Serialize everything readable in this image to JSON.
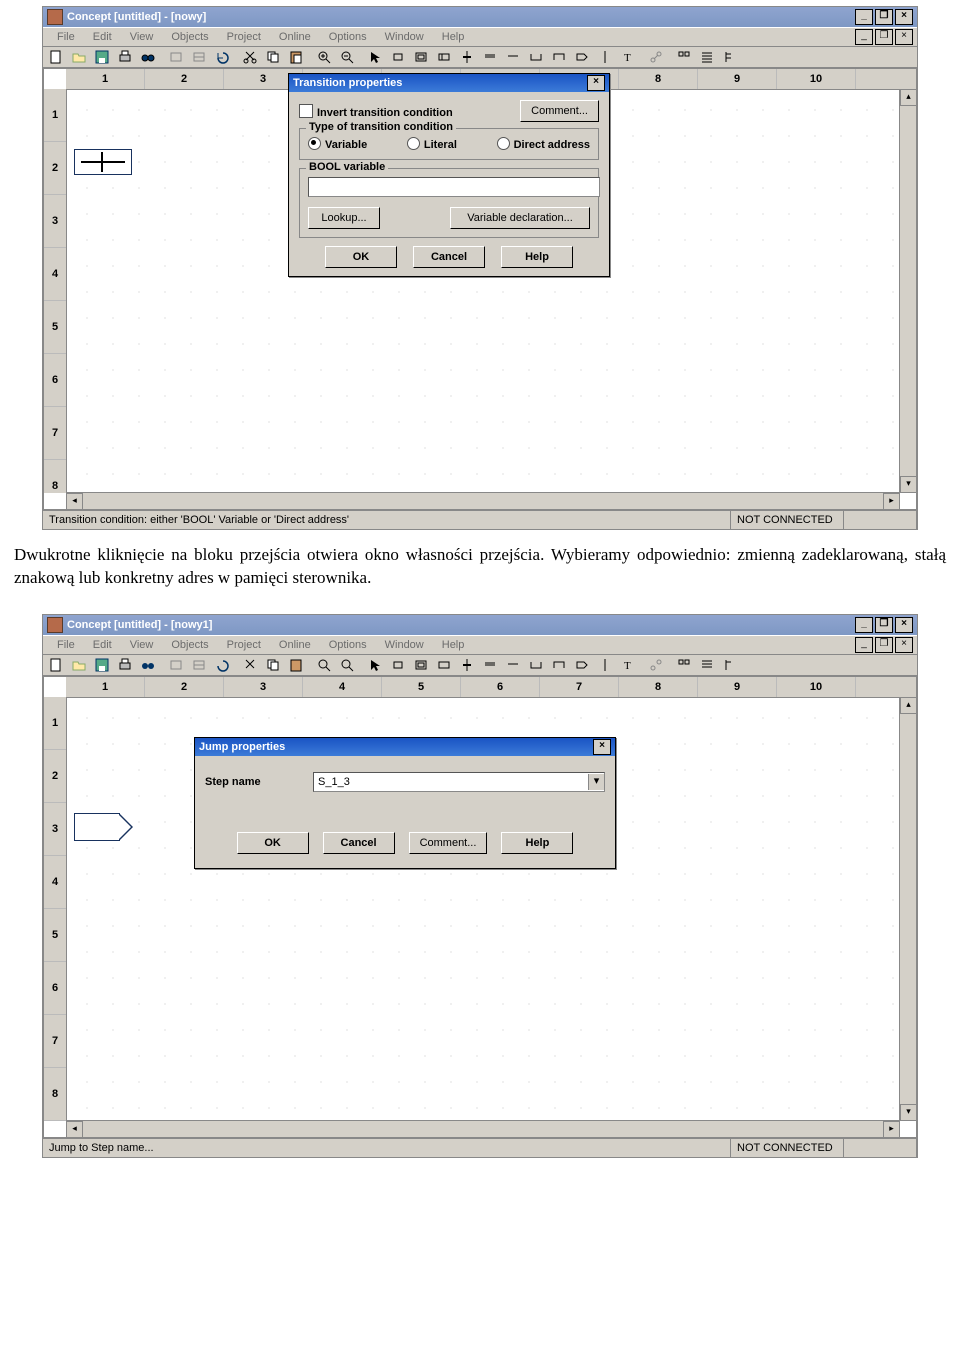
{
  "screenshot1": {
    "title": "Concept [untitled] - [nowy]",
    "menu": [
      "File",
      "Edit",
      "View",
      "Objects",
      "Project",
      "Online",
      "Options",
      "Window",
      "Help"
    ],
    "ruler_cols": [
      "1",
      "2",
      "3",
      "",
      "",
      "",
      "",
      "8",
      "9",
      "10"
    ],
    "ruler_rows": [
      "1",
      "2",
      "3",
      "4",
      "5",
      "6",
      "7",
      "8"
    ],
    "dialog": {
      "title": "Transition properties",
      "invert": "Invert transition condition",
      "comment": "Comment...",
      "group1_label": "Type of transition condition",
      "opt_variable": "Variable",
      "opt_literal": "Literal",
      "opt_direct": "Direct address",
      "group2_label": "BOOL variable",
      "lookup": "Lookup...",
      "vardecl": "Variable declaration...",
      "ok": "OK",
      "cancel": "Cancel",
      "help": "Help"
    },
    "status_left": "Transition condition: either 'BOOL' Variable or 'Direct address'",
    "status_right": "NOT CONNECTED"
  },
  "paragraph": "Dwukrotne kliknięcie na bloku przejścia otwiera okno własności przejścia. Wybieramy odpowiednio: zmienną zadeklarowaną, stałą znakową lub konkretny adres w pamięci sterownika.",
  "screenshot2": {
    "title": "Concept [untitled] - [nowy1]",
    "menu": [
      "File",
      "Edit",
      "View",
      "Objects",
      "Project",
      "Online",
      "Options",
      "Window",
      "Help"
    ],
    "ruler_cols": [
      "1",
      "2",
      "3",
      "4",
      "5",
      "6",
      "7",
      "8",
      "9",
      "10"
    ],
    "ruler_rows": [
      "1",
      "2",
      "3",
      "4",
      "5",
      "6",
      "7",
      "8"
    ],
    "dialog": {
      "title": "Jump properties",
      "step_name_lbl": "Step name",
      "step_name_val": "S_1_3",
      "ok": "OK",
      "cancel": "Cancel",
      "comment": "Comment...",
      "help": "Help"
    },
    "status_left": "Jump to Step name...",
    "status_right": "NOT CONNECTED"
  }
}
